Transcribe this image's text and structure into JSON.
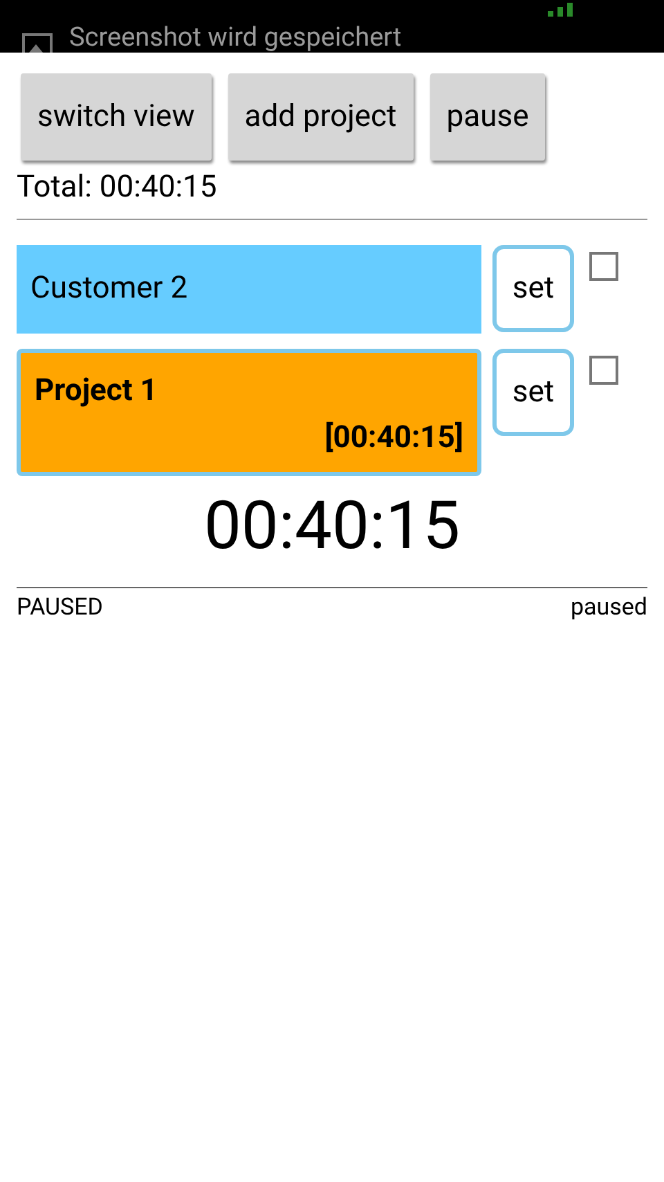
{
  "notification": {
    "text": "Screenshot wird gespeichert"
  },
  "toolbar": {
    "buttons": [
      "switch view",
      "add project",
      "pause"
    ]
  },
  "total": "Total: 00:40:15",
  "items": [
    {
      "kind": "customer",
      "name": "Customer 2",
      "selected": false,
      "button": "set",
      "checked": false
    },
    {
      "kind": "project",
      "name": "Project 1",
      "time": "[00:40:15]",
      "selected": true,
      "button": "set",
      "checked": false
    }
  ],
  "timer": "00:40:15",
  "footer": {
    "left": "PAUSED",
    "right": "paused"
  }
}
